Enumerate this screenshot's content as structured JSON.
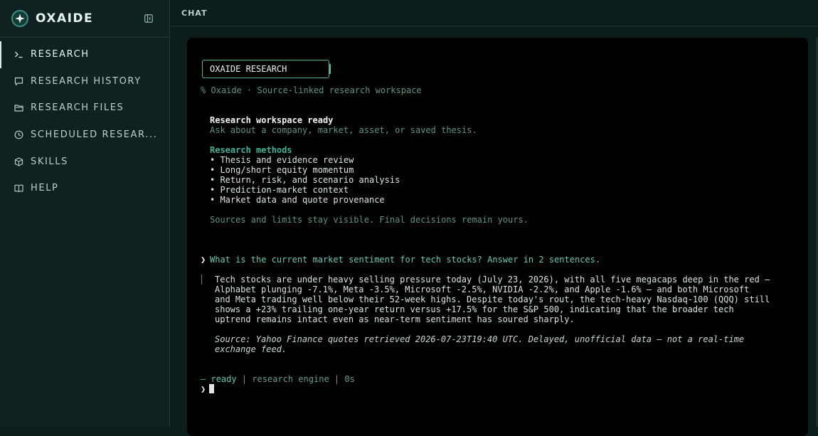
{
  "app": {
    "name": "OXAIDE"
  },
  "sidebar": {
    "items": [
      {
        "label": "RESEARCH",
        "icon": "terminal-prompt-icon",
        "active": true
      },
      {
        "label": "RESEARCH HISTORY",
        "icon": "chat-bubble-icon"
      },
      {
        "label": "RESEARCH FILES",
        "icon": "folder-icon"
      },
      {
        "label": "SCHEDULED RESEAR...",
        "icon": "clock-icon"
      },
      {
        "label": "SKILLS",
        "icon": "cube-icon"
      },
      {
        "label": "HELP",
        "icon": "book-icon"
      }
    ]
  },
  "header": {
    "title": "CHAT"
  },
  "terminal": {
    "title": "OXAIDE RESEARCH",
    "subtitle": "% Oxaide · Source-linked research workspace",
    "ready_heading": "Research workspace ready",
    "ready_hint": "Ask about a company, market, asset, or saved thesis.",
    "methods_heading": "Research methods",
    "methods": [
      "• Thesis and evidence review",
      "• Long/short equity momentum",
      "• Return, risk, and scenario analysis",
      "• Prediction-market context",
      "• Market data and quote provenance"
    ],
    "footer_note": "Sources and limits stay visible. Final decisions remain yours.",
    "prompt_symbol": "❯",
    "user_question": "What is the current market sentiment for tech stocks? Answer in 2 sentences.",
    "answer_lines": [
      "Tech stocks are under heavy selling pressure today (July 23, 2026), with all five megacaps deep in the red —",
      "Alphabet plunging -7.1%, Meta -3.5%, Microsoft -2.5%, NVIDIA -2.2%, and Apple -1.6% — and both Microsoft",
      "and Meta trading well below their 52-week highs. Despite today's rout, the tech-heavy Nasdaq-100 (QQQ) still",
      "shows a +23% trailing one-year return versus +17.5% for the S&P 500, indicating that the broader tech",
      "uptrend remains intact even as near-term sentiment has soured sharply."
    ],
    "source_lines": [
      "Source: Yahoo Finance quotes retrieved 2026-07-23T19:40 UTC. Delayed, unofficial data — not a real-time",
      "exchange feed."
    ],
    "status": {
      "dash": "—",
      "state": "ready",
      "sep": "|",
      "engine": "research engine",
      "elapsed": "0s"
    }
  },
  "colors": {
    "accent": "#3fb49a",
    "background": "#0b1c1b",
    "terminal_bg": "#000000"
  }
}
